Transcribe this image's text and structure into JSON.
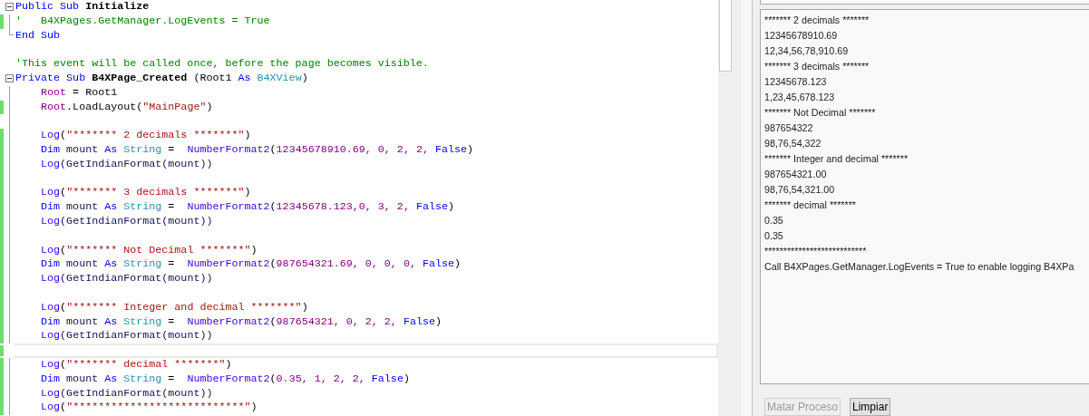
{
  "editor": {
    "lines": [
      {
        "kind": "fold-start",
        "modified": false,
        "current": false,
        "tokens": [
          {
            "kind": "keyword",
            "text": "Public Sub "
          },
          {
            "kind": "bold",
            "text": "Initialize"
          }
        ]
      },
      {
        "kind": "body",
        "modified": true,
        "current": false,
        "tokens": [
          {
            "kind": "comment",
            "text": "'   B4XPages.GetManager.LogEvents = True"
          }
        ]
      },
      {
        "kind": "fold-end",
        "modified": false,
        "current": false,
        "tokens": [
          {
            "kind": "keyword",
            "text": "End Sub"
          }
        ]
      },
      {
        "kind": "outside",
        "modified": false,
        "current": false
      },
      {
        "kind": "outside",
        "modified": false,
        "current": false,
        "tokens": [
          {
            "kind": "comment",
            "text": "'This event will be called once, before the page becomes visible."
          }
        ]
      },
      {
        "kind": "fold-start",
        "modified": false,
        "current": false,
        "tokens": [
          {
            "kind": "keyword",
            "text": "Private Sub "
          },
          {
            "kind": "bold",
            "text": "B4XPage_Created"
          },
          {
            "kind": "plain",
            "text": " (Root1 "
          },
          {
            "kind": "keyword",
            "text": "As "
          },
          {
            "kind": "type",
            "text": "B4XView"
          },
          {
            "kind": "plain",
            "text": ")"
          }
        ]
      },
      {
        "kind": "body",
        "modified": false,
        "current": false,
        "tokens": [
          {
            "kind": "variable",
            "text": "    Root"
          },
          {
            "kind": "plain",
            "text": " = Root1"
          }
        ]
      },
      {
        "kind": "body",
        "modified": true,
        "current": false,
        "tokens": [
          {
            "kind": "variable",
            "text": "    Root"
          },
          {
            "kind": "plain",
            "text": ".LoadLayout("
          },
          {
            "kind": "string",
            "text": "\"MainPage\""
          },
          {
            "kind": "plain",
            "text": ")"
          }
        ]
      },
      {
        "kind": "body",
        "modified": false,
        "current": false
      },
      {
        "kind": "body",
        "modified": true,
        "current": false,
        "tokens": [
          {
            "kind": "method",
            "text": "    Log"
          },
          {
            "kind": "plain",
            "text": "("
          },
          {
            "kind": "string",
            "text": "\"******* 2 decimals *******\""
          },
          {
            "kind": "plain",
            "text": ")"
          }
        ]
      },
      {
        "kind": "body",
        "modified": true,
        "current": false,
        "tokens": [
          {
            "kind": "keyword",
            "text": "    Dim "
          },
          {
            "kind": "name",
            "text": "mount "
          },
          {
            "kind": "keyword",
            "text": "As "
          },
          {
            "kind": "type",
            "text": "String"
          },
          {
            "kind": "plain",
            "text": " =  "
          },
          {
            "kind": "method",
            "text": "NumberFormat2"
          },
          {
            "kind": "plain",
            "text": "("
          },
          {
            "kind": "number",
            "text": "12345678910.69, 0, 2, 2, "
          },
          {
            "kind": "keyword",
            "text": "False"
          },
          {
            "kind": "plain",
            "text": ")"
          }
        ]
      },
      {
        "kind": "body",
        "modified": true,
        "current": false,
        "tokens": [
          {
            "kind": "method",
            "text": "    Log"
          },
          {
            "kind": "name",
            "text": "(GetIndianFormat(mount))"
          }
        ]
      },
      {
        "kind": "body",
        "modified": true,
        "current": false
      },
      {
        "kind": "body",
        "modified": true,
        "current": false,
        "tokens": [
          {
            "kind": "method",
            "text": "    Log"
          },
          {
            "kind": "plain",
            "text": "("
          },
          {
            "kind": "string",
            "text": "\"******* 3 decimals *******\""
          },
          {
            "kind": "plain",
            "text": ")"
          }
        ]
      },
      {
        "kind": "body",
        "modified": true,
        "current": false,
        "tokens": [
          {
            "kind": "keyword",
            "text": "    Dim "
          },
          {
            "kind": "name",
            "text": "mount "
          },
          {
            "kind": "keyword",
            "text": "As "
          },
          {
            "kind": "type",
            "text": "String"
          },
          {
            "kind": "plain",
            "text": " =  "
          },
          {
            "kind": "method",
            "text": "NumberFormat2"
          },
          {
            "kind": "plain",
            "text": "("
          },
          {
            "kind": "number",
            "text": "12345678.123,0, 3, 2, "
          },
          {
            "kind": "keyword",
            "text": "False"
          },
          {
            "kind": "plain",
            "text": ")"
          }
        ]
      },
      {
        "kind": "body",
        "modified": true,
        "current": false,
        "tokens": [
          {
            "kind": "method",
            "text": "    Log"
          },
          {
            "kind": "name",
            "text": "(GetIndianFormat(mount))"
          }
        ]
      },
      {
        "kind": "body",
        "modified": true,
        "current": false
      },
      {
        "kind": "body",
        "modified": true,
        "current": false,
        "tokens": [
          {
            "kind": "method",
            "text": "    Log"
          },
          {
            "kind": "plain",
            "text": "("
          },
          {
            "kind": "string",
            "text": "\"******* Not Decimal *******\""
          },
          {
            "kind": "plain",
            "text": ")"
          }
        ]
      },
      {
        "kind": "body",
        "modified": true,
        "current": false,
        "tokens": [
          {
            "kind": "keyword",
            "text": "    Dim "
          },
          {
            "kind": "name",
            "text": "mount "
          },
          {
            "kind": "keyword",
            "text": "As "
          },
          {
            "kind": "type",
            "text": "String"
          },
          {
            "kind": "plain",
            "text": " =  "
          },
          {
            "kind": "method",
            "text": "NumberFormat2"
          },
          {
            "kind": "plain",
            "text": "("
          },
          {
            "kind": "number",
            "text": "987654321.69, 0, 0, 0, "
          },
          {
            "kind": "keyword",
            "text": "False"
          },
          {
            "kind": "plain",
            "text": ")"
          }
        ]
      },
      {
        "kind": "body",
        "modified": true,
        "current": false,
        "tokens": [
          {
            "kind": "method",
            "text": "    Log"
          },
          {
            "kind": "name",
            "text": "(GetIndianFormat(mount))"
          }
        ]
      },
      {
        "kind": "body",
        "modified": true,
        "current": false
      },
      {
        "kind": "body",
        "modified": true,
        "current": false,
        "tokens": [
          {
            "kind": "method",
            "text": "    Log"
          },
          {
            "kind": "plain",
            "text": "("
          },
          {
            "kind": "string",
            "text": "\"******* Integer and decimal *******\""
          },
          {
            "kind": "plain",
            "text": ")"
          }
        ]
      },
      {
        "kind": "body",
        "modified": true,
        "current": false,
        "tokens": [
          {
            "kind": "keyword",
            "text": "    Dim "
          },
          {
            "kind": "name",
            "text": "mount "
          },
          {
            "kind": "keyword",
            "text": "As "
          },
          {
            "kind": "type",
            "text": "String"
          },
          {
            "kind": "plain",
            "text": " =  "
          },
          {
            "kind": "method",
            "text": "NumberFormat2"
          },
          {
            "kind": "plain",
            "text": "("
          },
          {
            "kind": "number",
            "text": "987654321, 0, 2, 2, "
          },
          {
            "kind": "keyword",
            "text": "False"
          },
          {
            "kind": "plain",
            "text": ")"
          }
        ]
      },
      {
        "kind": "body",
        "modified": true,
        "current": false,
        "tokens": [
          {
            "kind": "method",
            "text": "    Log"
          },
          {
            "kind": "name",
            "text": "(GetIndianFormat(mount))"
          }
        ]
      },
      {
        "kind": "body",
        "modified": true,
        "current": true
      },
      {
        "kind": "body",
        "modified": true,
        "current": false,
        "tokens": [
          {
            "kind": "method",
            "text": "    Log"
          },
          {
            "kind": "plain",
            "text": "("
          },
          {
            "kind": "string",
            "text": "\"******* decimal *******\""
          },
          {
            "kind": "plain",
            "text": ")"
          }
        ]
      },
      {
        "kind": "body",
        "modified": true,
        "current": false,
        "tokens": [
          {
            "kind": "keyword",
            "text": "    Dim "
          },
          {
            "kind": "name",
            "text": "mount "
          },
          {
            "kind": "keyword",
            "text": "As "
          },
          {
            "kind": "type",
            "text": "String"
          },
          {
            "kind": "plain",
            "text": " =  "
          },
          {
            "kind": "method",
            "text": "NumberFormat2"
          },
          {
            "kind": "plain",
            "text": "("
          },
          {
            "kind": "number",
            "text": "0.35, 1, 2, 2, "
          },
          {
            "kind": "keyword",
            "text": "False"
          },
          {
            "kind": "plain",
            "text": ")"
          }
        ]
      },
      {
        "kind": "body",
        "modified": true,
        "current": false,
        "tokens": [
          {
            "kind": "method",
            "text": "    Log"
          },
          {
            "kind": "name",
            "text": "(GetIndianFormat(mount))"
          }
        ]
      },
      {
        "kind": "body",
        "modified": true,
        "current": false,
        "tokens": [
          {
            "kind": "method",
            "text": "    Log"
          },
          {
            "kind": "plain",
            "text": "("
          },
          {
            "kind": "string",
            "text": "\"***************************\""
          },
          {
            "kind": "plain",
            "text": ")"
          }
        ]
      }
    ]
  },
  "logs": [
    "******* 2 decimals *******",
    "12345678910.69",
    "12,34,56,78,910.69",
    "******* 3 decimals *******",
    "12345678.123",
    "1,23,45,678.123",
    "******* Not Decimal *******",
    "987654322",
    "98,76,54,322",
    "******* Integer and decimal *******",
    "987654321.00",
    "98,76,54,321.00",
    "******* decimal *******",
    "0.35",
    "0.35",
    "***************************",
    "Call B4XPages.GetManager.LogEvents = True to enable logging B4XPa"
  ],
  "buttons": [
    {
      "label": "Matar Proceso",
      "disabled": true
    },
    {
      "label": "Limpiar",
      "disabled": false
    }
  ]
}
